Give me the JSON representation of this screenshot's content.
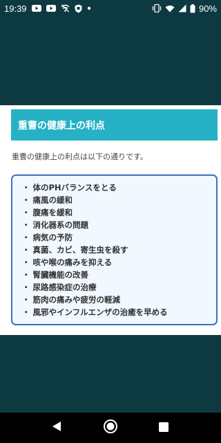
{
  "status_bar": {
    "time": "19:39",
    "battery": "90%",
    "left_icons": [
      "youtube-icon",
      "youtube-icon",
      "wifi-off-icon",
      "shield-icon",
      "dot-icon"
    ],
    "right_icons": [
      "vibrate-icon",
      "wifi-icon",
      "signal-icon",
      "battery-icon"
    ]
  },
  "section": {
    "title": "重曹の健康上の利点",
    "intro": "重曹の健康上の利点は以下の通りです。"
  },
  "benefits": {
    "bullet": "・",
    "items": [
      "体のPHバランスをとる",
      "痛風の緩和",
      "腹痛を緩和",
      "消化器系の問題",
      "病気の予防",
      "真菌、カビ、寄生虫を殺す",
      "咳や喉の痛みを抑える",
      "腎臓機能の改善",
      "尿路感染症の治療",
      "筋肉の痛みや疲労の軽減",
      "風邪やインフルエンザの治癒を早める"
    ]
  },
  "nav_bar": {
    "icons": [
      "back-icon",
      "home-icon",
      "recents-icon"
    ]
  },
  "colors": {
    "background": "#0d3a41",
    "header_accent": "#27b1c6",
    "box_border": "#3c6fc0",
    "box_background": "#f1f8ff"
  }
}
